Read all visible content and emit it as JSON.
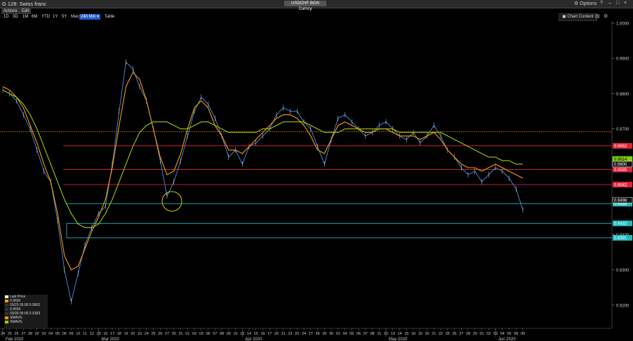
{
  "window": {
    "title": "G 128: Swiss franc",
    "ticker": "USDCHF BGN Curncy",
    "options_label": "Options",
    "icons": [
      "help-icon",
      "minimize-icon",
      "maximize-icon",
      "close-icon"
    ]
  },
  "menu": [
    "Actions",
    "Edit"
  ],
  "ranges": [
    "1D",
    "3D",
    "1M",
    "6M",
    "YTD",
    "1Y",
    "5Y",
    "Max",
    "240 Min",
    "Table"
  ],
  "active_range": "240 Min",
  "chart_content_label": "Chart Content",
  "legend": {
    "items": [
      {
        "label": "Last Price",
        "color": "#ffffff"
      },
      {
        "label": "0.9692",
        "color": "#ff9a00"
      },
      {
        "label": "03/23 05:00 0.9902",
        "color": "#333333"
      },
      {
        "label": "0.9659",
        "color": "#333333"
      },
      {
        "label": "03/09 05:00 0.9183",
        "color": "#333333"
      },
      {
        "label": "SMAVG",
        "color": "#ff9a00"
      },
      {
        "label": "SMAVG",
        "color": "#9acd00"
      }
    ]
  },
  "chart_data": {
    "type": "line",
    "ylim": [
      0.915,
      1.0
    ],
    "y_ticks": [
      "1.0000",
      "0.9900",
      "0.9800",
      "0.9700",
      "0.9600",
      "0.9500",
      "0.9400",
      "0.9300",
      "0.9200"
    ],
    "y_tick_values": [
      1.0,
      0.99,
      0.98,
      0.97,
      0.96,
      0.95,
      0.94,
      0.93,
      0.92
    ],
    "x_labels": [
      "24",
      "25",
      "26",
      "27",
      "28",
      "02",
      "03",
      "04",
      "05",
      "06",
      "09",
      "10",
      "11",
      "12",
      "13",
      "16",
      "17",
      "18",
      "19",
      "20",
      "23",
      "24",
      "25",
      "26",
      "27",
      "30",
      "31",
      "01",
      "02",
      "03",
      "06",
      "07",
      "08",
      "09",
      "10",
      "13",
      "14",
      "15",
      "16",
      "17",
      "20",
      "21",
      "22",
      "23",
      "24",
      "27",
      "28",
      "29",
      "30",
      "01",
      "04",
      "05",
      "06",
      "07",
      "08",
      "11",
      "12",
      "13",
      "14",
      "15",
      "18",
      "19",
      "20",
      "21",
      "22",
      "25",
      "26",
      "27",
      "28",
      "29",
      "01",
      "02",
      "03",
      "04",
      "05",
      "08",
      "09"
    ],
    "month_labels": [
      {
        "label": "Feb 2020",
        "after_index": 0
      },
      {
        "label": "Mar 2020",
        "after_index": 14
      },
      {
        "label": "Apr 2020",
        "after_index": 35
      },
      {
        "label": "May 2020",
        "after_index": 56
      },
      {
        "label": "Jun 2020",
        "after_index": 72
      }
    ],
    "horizontal_levels": [
      {
        "value": 0.9692,
        "color": "#ff9a00",
        "style": "dotted",
        "label": ""
      },
      {
        "value": 0.9652,
        "color": "#e0223a",
        "style": "solid",
        "label": "0.9652"
      },
      {
        "value": 0.9585,
        "color": "#e0223a",
        "style": "solid",
        "label": "0.9585"
      },
      {
        "value": 0.9542,
        "color": "#e0223a",
        "style": "solid",
        "label": "0.9542"
      },
      {
        "value": 0.9488,
        "color": "#1fbcbc",
        "style": "solid",
        "label": "0.9488"
      },
      {
        "value": 0.9432,
        "color": "#1fbcbc",
        "style": "solid",
        "label": "0.9432"
      },
      {
        "value": 0.9391,
        "color": "#1fbcbc",
        "style": "solid",
        "label": "0.9391"
      }
    ],
    "value_tags": [
      {
        "value": 0.9614,
        "label": "0.9614",
        "color": "#7dd000"
      },
      {
        "value": 0.96,
        "label": "0.9600",
        "color": "#ffffff"
      },
      {
        "value": 0.9498,
        "label": "0.9498",
        "color": "#ffffff"
      }
    ],
    "series": [
      {
        "name": "Last Price",
        "color": "#4a90e2",
        "x": [
          0,
          1,
          2,
          3,
          4,
          5,
          6,
          7,
          8,
          9,
          10,
          11,
          12,
          13,
          14,
          15,
          16,
          17,
          18,
          19,
          20,
          21,
          22,
          23,
          24,
          25,
          26,
          27,
          28,
          29,
          30,
          31,
          32,
          33,
          34,
          35,
          36,
          37,
          38,
          39,
          40,
          41,
          42,
          43,
          44,
          45,
          46,
          47,
          48,
          49,
          50,
          51,
          52,
          53,
          54,
          55,
          56,
          57,
          58,
          59,
          60,
          61,
          62,
          63,
          64,
          65,
          66,
          67,
          68,
          69,
          70,
          71,
          72,
          73,
          74,
          75,
          76
        ],
        "values": [
          0.981,
          0.98,
          0.978,
          0.974,
          0.97,
          0.964,
          0.958,
          0.955,
          0.944,
          0.93,
          0.921,
          0.929,
          0.937,
          0.942,
          0.946,
          0.948,
          0.96,
          0.975,
          0.989,
          0.987,
          0.982,
          0.978,
          0.97,
          0.961,
          0.951,
          0.955,
          0.961,
          0.968,
          0.975,
          0.979,
          0.977,
          0.973,
          0.968,
          0.962,
          0.964,
          0.96,
          0.965,
          0.966,
          0.968,
          0.97,
          0.974,
          0.976,
          0.975,
          0.975,
          0.972,
          0.97,
          0.965,
          0.96,
          0.967,
          0.973,
          0.974,
          0.972,
          0.97,
          0.968,
          0.969,
          0.971,
          0.972,
          0.97,
          0.968,
          0.967,
          0.969,
          0.966,
          0.968,
          0.971,
          0.968,
          0.964,
          0.962,
          0.959,
          0.957,
          0.958,
          0.955,
          0.957,
          0.959,
          0.958,
          0.956,
          0.953,
          0.947
        ]
      },
      {
        "name": "SMAVG",
        "color": "#ff9a00",
        "x": [
          0,
          1,
          2,
          3,
          4,
          5,
          6,
          7,
          8,
          9,
          10,
          11,
          12,
          13,
          14,
          15,
          16,
          17,
          18,
          19,
          20,
          21,
          22,
          23,
          24,
          25,
          26,
          27,
          28,
          29,
          30,
          31,
          32,
          33,
          34,
          35,
          36,
          37,
          38,
          39,
          40,
          41,
          42,
          43,
          44,
          45,
          46,
          47,
          48,
          49,
          50,
          51,
          52,
          53,
          54,
          55,
          56,
          57,
          58,
          59,
          60,
          61,
          62,
          63,
          64,
          65,
          66,
          67,
          68,
          69,
          70,
          71,
          72,
          73,
          74,
          75,
          76
        ],
        "values": [
          0.982,
          0.981,
          0.979,
          0.976,
          0.971,
          0.966,
          0.96,
          0.955,
          0.946,
          0.934,
          0.93,
          0.931,
          0.936,
          0.941,
          0.945,
          0.95,
          0.959,
          0.971,
          0.982,
          0.986,
          0.984,
          0.978,
          0.97,
          0.962,
          0.957,
          0.958,
          0.963,
          0.97,
          0.976,
          0.978,
          0.976,
          0.971,
          0.968,
          0.964,
          0.964,
          0.963,
          0.965,
          0.967,
          0.969,
          0.971,
          0.973,
          0.974,
          0.974,
          0.973,
          0.971,
          0.968,
          0.964,
          0.963,
          0.967,
          0.971,
          0.972,
          0.971,
          0.97,
          0.969,
          0.969,
          0.97,
          0.97,
          0.969,
          0.968,
          0.968,
          0.968,
          0.967,
          0.968,
          0.969,
          0.967,
          0.964,
          0.962,
          0.96,
          0.959,
          0.959,
          0.958,
          0.959,
          0.96,
          0.959,
          0.958,
          0.957,
          0.956
        ]
      },
      {
        "name": "SMAVG",
        "color": "#9acd00",
        "x": [
          0,
          1,
          2,
          3,
          4,
          5,
          6,
          7,
          8,
          9,
          10,
          11,
          12,
          13,
          14,
          15,
          16,
          17,
          18,
          19,
          20,
          21,
          22,
          23,
          24,
          25,
          26,
          27,
          28,
          29,
          30,
          31,
          32,
          33,
          34,
          35,
          36,
          37,
          38,
          39,
          40,
          41,
          42,
          43,
          44,
          45,
          46,
          47,
          48,
          49,
          50,
          51,
          52,
          53,
          54,
          55,
          56,
          57,
          58,
          59,
          60,
          61,
          62,
          63,
          64,
          65,
          66,
          67,
          68,
          69,
          70,
          71,
          72,
          73,
          74,
          75,
          76
        ],
        "values": [
          0.981,
          0.98,
          0.979,
          0.977,
          0.974,
          0.97,
          0.965,
          0.96,
          0.955,
          0.95,
          0.946,
          0.943,
          0.942,
          0.942,
          0.943,
          0.946,
          0.95,
          0.955,
          0.96,
          0.965,
          0.969,
          0.971,
          0.972,
          0.972,
          0.972,
          0.971,
          0.97,
          0.97,
          0.971,
          0.972,
          0.972,
          0.971,
          0.97,
          0.969,
          0.969,
          0.969,
          0.969,
          0.969,
          0.97,
          0.97,
          0.971,
          0.972,
          0.972,
          0.972,
          0.972,
          0.971,
          0.97,
          0.969,
          0.969,
          0.969,
          0.97,
          0.97,
          0.97,
          0.97,
          0.97,
          0.97,
          0.97,
          0.97,
          0.969,
          0.969,
          0.969,
          0.969,
          0.969,
          0.969,
          0.969,
          0.968,
          0.967,
          0.966,
          0.965,
          0.964,
          0.963,
          0.962,
          0.962,
          0.961,
          0.961,
          0.96,
          0.96
        ]
      }
    ]
  }
}
